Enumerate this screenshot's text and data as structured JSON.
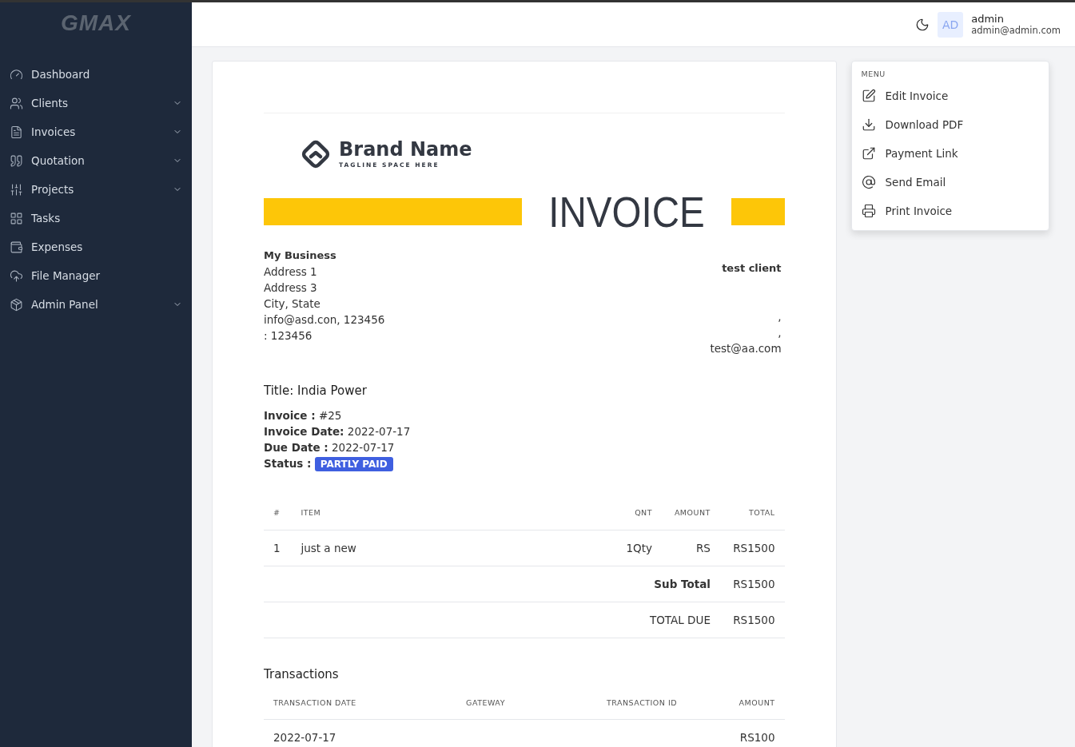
{
  "sidebar": {
    "logo": "GMAX",
    "items": [
      {
        "label": "Dashboard",
        "has_submenu": false
      },
      {
        "label": "Clients",
        "has_submenu": true
      },
      {
        "label": "Invoices",
        "has_submenu": true
      },
      {
        "label": "Quotation",
        "has_submenu": true
      },
      {
        "label": "Projects",
        "has_submenu": true
      },
      {
        "label": "Tasks",
        "has_submenu": false
      },
      {
        "label": "Expenses",
        "has_submenu": false
      },
      {
        "label": "File Manager",
        "has_submenu": false
      },
      {
        "label": "Admin Panel",
        "has_submenu": true
      }
    ]
  },
  "topbar": {
    "avatar": "AD",
    "user_name": "admin",
    "user_email": "admin@admin.com"
  },
  "invoice": {
    "brand": {
      "name": "Brand Name",
      "tagline": "TAGLINE SPACE HERE"
    },
    "heading": "INVOICE",
    "business": {
      "name": "My Business",
      "lines": [
        "Address 1",
        "Address 3",
        "City, State",
        "info@asd.con, 123456",
        ": 123456"
      ]
    },
    "client": {
      "name": "test client",
      "lines": [
        ",",
        ",",
        "test@aa.com"
      ]
    },
    "title": "Title: India Power",
    "fields": [
      {
        "label": "Invoice :",
        "value": "#25"
      },
      {
        "label": "Invoice Date:",
        "value": "2022-07-17"
      },
      {
        "label": "Due Date :",
        "value": "2022-07-17"
      }
    ],
    "status": {
      "label": "Status :",
      "badge": "PARTLY PAID"
    },
    "items": {
      "columns": [
        "#",
        "ITEM",
        "QNT",
        "AMOUNT",
        "TOTAL"
      ],
      "rows": [
        {
          "number": "1",
          "item": "just a new",
          "qnt": "1Qty",
          "amount": "RS",
          "total": "RS1500"
        }
      ],
      "summary": [
        {
          "label": "Sub Total",
          "value": "RS1500",
          "emphasis": true
        },
        {
          "label": "TOTAL DUE",
          "value": "RS1500",
          "emphasis": false
        }
      ]
    },
    "transactions": {
      "title": "Transactions",
      "columns": [
        "TRANSACTION DATE",
        "GATEWAY",
        "TRANSACTION ID",
        "AMOUNT"
      ],
      "rows": [
        {
          "transaction_date": "2022-07-17",
          "amount": "RS100"
        }
      ]
    }
  },
  "menu": {
    "title": "MENU",
    "items": [
      "Edit Invoice",
      "Download PDF",
      "Payment Link",
      "Send Email",
      "Print Invoice"
    ]
  }
}
